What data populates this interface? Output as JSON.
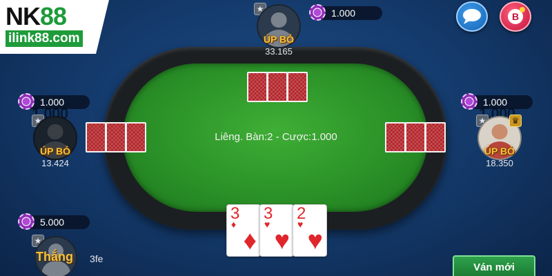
{
  "logo": {
    "brand_left": "NK",
    "brand_right": "88",
    "site": "ilink88.com"
  },
  "table": {
    "status": "Liêng. Bàn:2 - Cược:1.000"
  },
  "players": {
    "top": {
      "name": "ÚP BỎ",
      "money": "33.165",
      "chips": "1.000"
    },
    "left": {
      "name": "ÚP BỎ",
      "money": "13.424",
      "chips": "1.000",
      "bet": "1.000"
    },
    "right": {
      "name": "ÚP BỎ",
      "money": "18.350",
      "chips": "1.000",
      "bet": "1.000"
    },
    "me": {
      "name": "Thắng",
      "chips": "5.000",
      "label": "3fe"
    }
  },
  "my_cards": [
    {
      "rank": "3",
      "suit": "♦"
    },
    {
      "rank": "3",
      "suit": "♥"
    },
    {
      "rank": "2",
      "suit": "♥"
    }
  ],
  "buttons": {
    "chat_icon": "chat-bubble-icon",
    "shop_icon": "shop-icon",
    "new_game": "Ván mới"
  },
  "colors": {
    "felt": "#2b9228",
    "card_back": "#b3262b",
    "chip": "#b04ad6",
    "name_gold": "#f3c33b"
  }
}
